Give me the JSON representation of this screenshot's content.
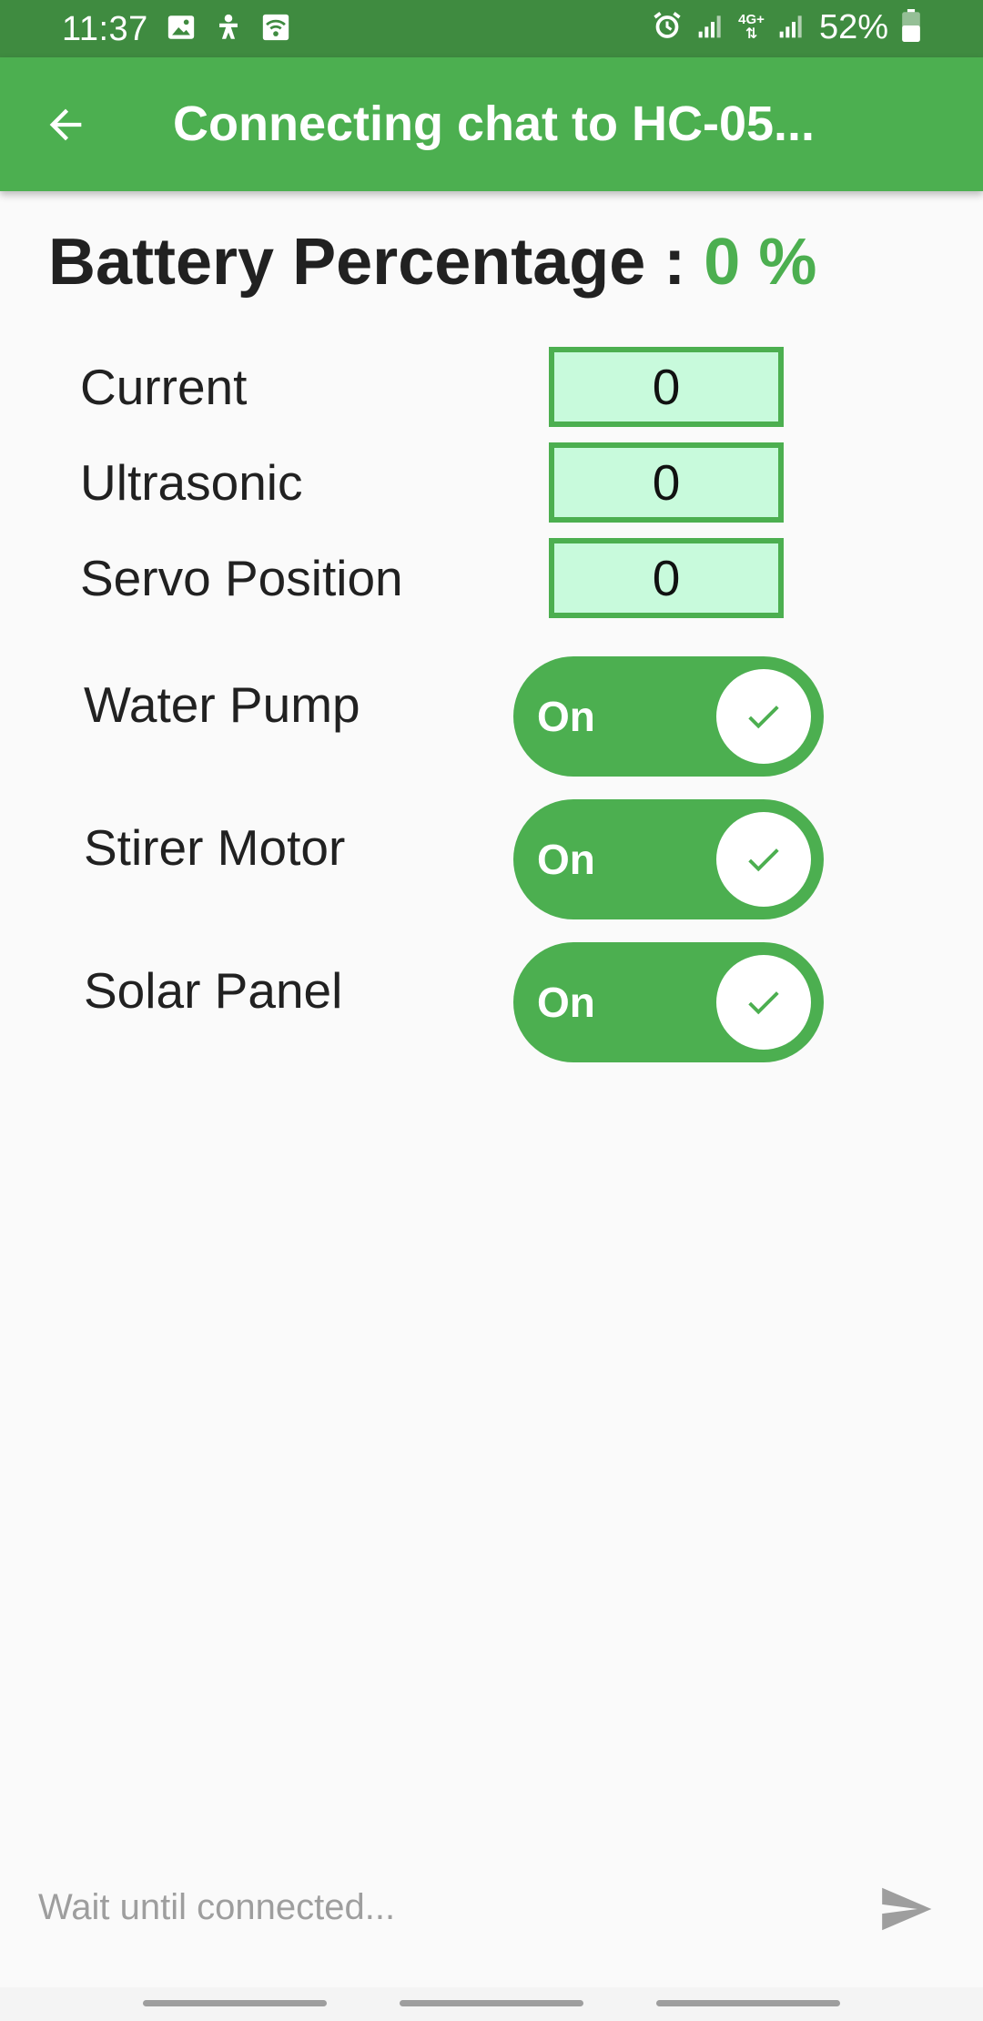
{
  "status_bar": {
    "time": "11:37",
    "network": "4G+",
    "battery": "52%"
  },
  "app_bar": {
    "title": "Connecting chat to HC-05..."
  },
  "battery": {
    "label": "Battery Percentage : ",
    "value": "0 %"
  },
  "readings": [
    {
      "label": "Current",
      "value": "0"
    },
    {
      "label": "Ultrasonic",
      "value": "0"
    },
    {
      "label": "Servo Position",
      "value": "0"
    }
  ],
  "toggles": [
    {
      "label": "Water Pump",
      "state": "On"
    },
    {
      "label": "Stirer Motor",
      "state": "On"
    },
    {
      "label": "Solar Panel",
      "state": "On"
    }
  ],
  "composer": {
    "placeholder": "Wait until connected..."
  },
  "colors": {
    "status_bar": "#3f8b40",
    "app_bar": "#4caf50",
    "accent": "#4caf50",
    "reading_fill": "#c8fadc"
  }
}
